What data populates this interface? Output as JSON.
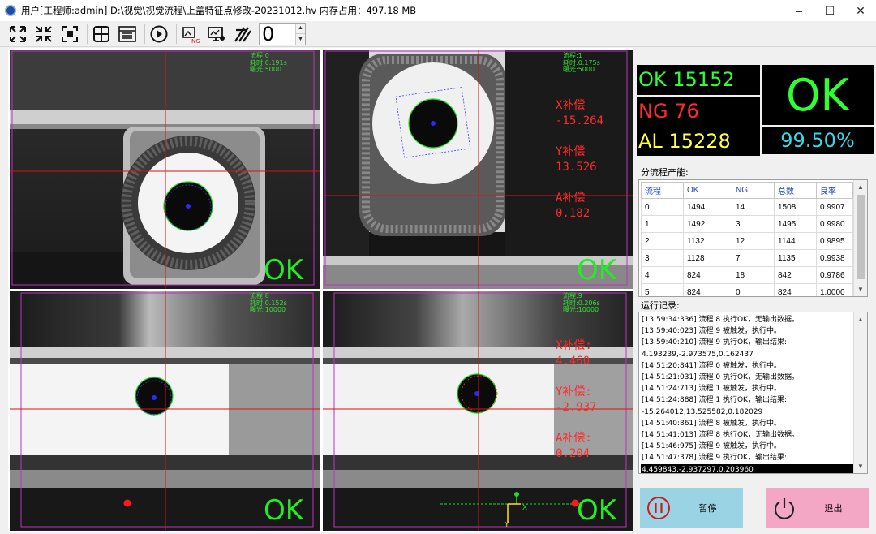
{
  "window": {
    "title": "用户[工程师:admin] D:\\视觉\\视觉流程\\上盖特征点修改-20231012.hv 内存占用：497.18 MB"
  },
  "toolbar": {
    "counter_value": "0",
    "icons": [
      "fit-all-icon",
      "shrink-icon",
      "fit-window-icon",
      "crosshair-icon",
      "layout-icon",
      "run-icon",
      "ng-image-icon",
      "monitor-icon",
      "stripes-icon"
    ]
  },
  "panes": [
    {
      "info": "流程:0\n耗时:0.191s\n曝光:5000",
      "result": "OK",
      "comp": null
    },
    {
      "info": "流程:1\n耗时:0.175s\n曝光:5000",
      "result": "OK",
      "comp": {
        "x_label": "X补偿",
        "x_value": "-15.264",
        "y_label": "Y补偿",
        "y_value": "13.526",
        "a_label": "A补偿",
        "a_value": "0.182"
      }
    },
    {
      "info": "流程:8\n耗时:0.152s\n曝光:10000",
      "result": "OK",
      "comp": null
    },
    {
      "info": "流程:9\n耗时:0.206s\n曝光:10000",
      "result": "OK",
      "comp": {
        "x_label": "X补偿:",
        "x_value": "4.460",
        "y_label": "Y补偿:",
        "y_value": "-2.937",
        "a_label": "A补偿:",
        "a_value": "0.204"
      },
      "axis_x": "X",
      "axis_y": "Y"
    }
  ],
  "stats": {
    "ok": "OK 15152",
    "ng": "NG 76",
    "al": "AL 15228",
    "result": "OK",
    "yield": "99.50%",
    "colors": {
      "ok": "#2fff2f",
      "ng": "#ff2a2a",
      "al": "#ffff40",
      "yield": "#3ad7e8"
    }
  },
  "flow_table": {
    "label": "分流程产能:",
    "headers": [
      "流程",
      "OK",
      "NG",
      "总数",
      "良率"
    ],
    "rows": [
      [
        "0",
        "1494",
        "14",
        "1508",
        "0.9907"
      ],
      [
        "1",
        "1492",
        "3",
        "1495",
        "0.9980"
      ],
      [
        "2",
        "1132",
        "12",
        "1144",
        "0.9895"
      ],
      [
        "3",
        "1128",
        "7",
        "1135",
        "0.9938"
      ],
      [
        "4",
        "824",
        "18",
        "842",
        "0.9786"
      ],
      [
        "5",
        "824",
        "0",
        "824",
        "1.0000"
      ]
    ]
  },
  "log": {
    "label": "运行记录:",
    "lines": [
      "[13:59:34:336] 流程 8 执行OK，无输出数据。",
      "[13:59:40:023] 流程 9 被触发，执行中。",
      "[13:59:40:210] 流程 9 执行OK，输出结果:",
      "4.193239,-2.973575,0.162437",
      "[14:51:20:841] 流程 0 被触发，执行中。",
      "[14:51:21:031] 流程 0 执行OK，无输出数据。",
      "[14:51:24:713] 流程 1 被触发，执行中。",
      "[14:51:24:888] 流程 1 执行OK，输出结果:",
      "-15.264012,13.525582,0.182029",
      "[14:51:40:861] 流程 8 被触发，执行中。",
      "[14:51:41:013] 流程 8 执行OK，无输出数据。",
      "[14:51:46:975] 流程 9 被触发，执行中。",
      "[14:51:47:378] 流程 9 执行OK，输出结果:",
      "4.459843,-2.937297,0.203960"
    ]
  },
  "buttons": {
    "pause": "暂停",
    "exit": "退出",
    "pause_color": "#9ad4e4",
    "exit_color": "#f4a7c4"
  }
}
